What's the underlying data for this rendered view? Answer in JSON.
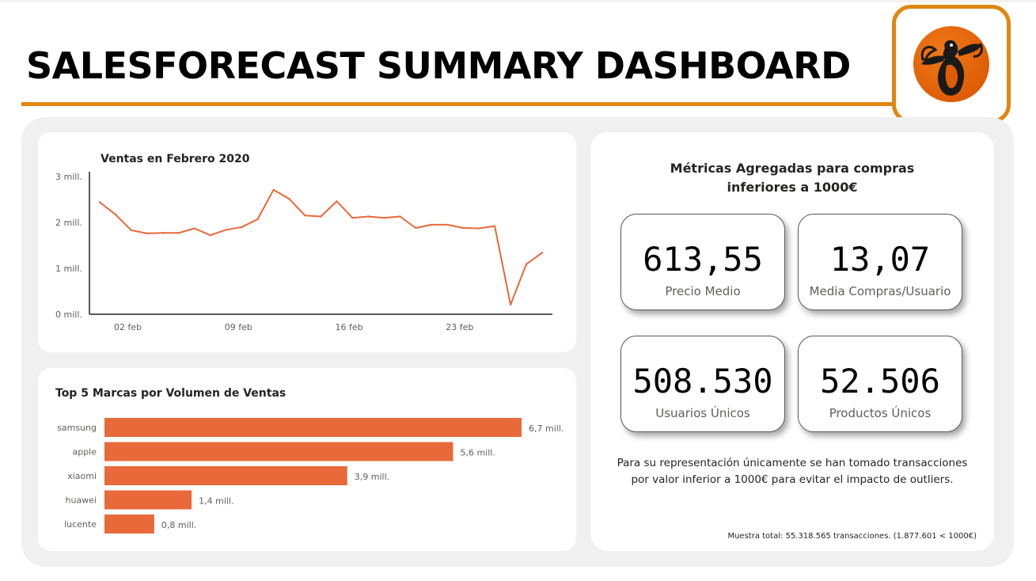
{
  "page": {
    "title": "SALESFORECAST SUMMARY DASHBOARD"
  },
  "colors": {
    "accent": "#e1870f",
    "bar": "#e8693a",
    "line": "#e8693a",
    "panel": "#f0f0f0"
  },
  "logo": {
    "icon": "penguin-logo-icon"
  },
  "chart_data": [
    {
      "type": "line",
      "title": "Ventas en Febrero 2020",
      "x": [
        "2020-02-01",
        "2020-02-02",
        "2020-02-03",
        "2020-02-04",
        "2020-02-05",
        "2020-02-06",
        "2020-02-07",
        "2020-02-08",
        "2020-02-09",
        "2020-02-10",
        "2020-02-11",
        "2020-02-12",
        "2020-02-13",
        "2020-02-14",
        "2020-02-15",
        "2020-02-16",
        "2020-02-17",
        "2020-02-18",
        "2020-02-19",
        "2020-02-20",
        "2020-02-21",
        "2020-02-22",
        "2020-02-23",
        "2020-02-24",
        "2020-02-25",
        "2020-02-26",
        "2020-02-27",
        "2020-02-28",
        "2020-02-29"
      ],
      "values": [
        2.44,
        2.17,
        1.83,
        1.76,
        1.77,
        1.77,
        1.87,
        1.72,
        1.84,
        1.9,
        2.07,
        2.71,
        2.51,
        2.15,
        2.13,
        2.46,
        2.1,
        2.13,
        2.1,
        2.13,
        1.88,
        1.95,
        1.95,
        1.88,
        1.87,
        1.92,
        0.21,
        1.09,
        1.34
      ],
      "xticks": [
        {
          "date": "2020-02-02",
          "label": "02 feb"
        },
        {
          "date": "2020-02-09",
          "label": "09 feb"
        },
        {
          "date": "2020-02-16",
          "label": "16 feb"
        },
        {
          "date": "2020-02-23",
          "label": "23 feb"
        }
      ],
      "yticks": [
        {
          "value": 0,
          "label": "0 mill."
        },
        {
          "value": 1,
          "label": "1 mill."
        },
        {
          "value": 2,
          "label": "2 mill."
        },
        {
          "value": 3,
          "label": "3 mill."
        }
      ],
      "ylim": [
        0,
        3
      ],
      "xlabel": "",
      "ylabel": "",
      "grid": false
    },
    {
      "type": "bar",
      "orientation": "horizontal",
      "title": "Top 5 Marcas por Volumen de Ventas",
      "categories": [
        "samsung",
        "apple",
        "xiaomi",
        "huawei",
        "lucente"
      ],
      "values": [
        6.7,
        5.6,
        3.9,
        1.4,
        0.8
      ],
      "value_labels": [
        "6,7 mill.",
        "5,6 mill.",
        "3,9 mill.",
        "1,4 mill.",
        "0,8 mill."
      ],
      "xlim": [
        0,
        6.7
      ],
      "xlabel": "",
      "ylabel": "",
      "grid": false
    }
  ],
  "metrics": {
    "title_line1": "Métricas Agregadas para compras",
    "title_line2": "inferiores a 1000€",
    "cards": [
      {
        "value": "613,55",
        "label": "Precio Medio"
      },
      {
        "value": "13,07",
        "label": "Media Compras/Usuario"
      },
      {
        "value": "508.530",
        "label": "Usuarios Únicos"
      },
      {
        "value": "52.506",
        "label": "Productos Únicos"
      }
    ],
    "note_line1": "Para su representación únicamente se han tomado transacciones",
    "note_line2": "por valor inferior a 1000€ para evitar el impacto de outliers.",
    "sample": "Muestra total: 55.318.565 transacciones. (1.877.601 < 1000€)"
  }
}
